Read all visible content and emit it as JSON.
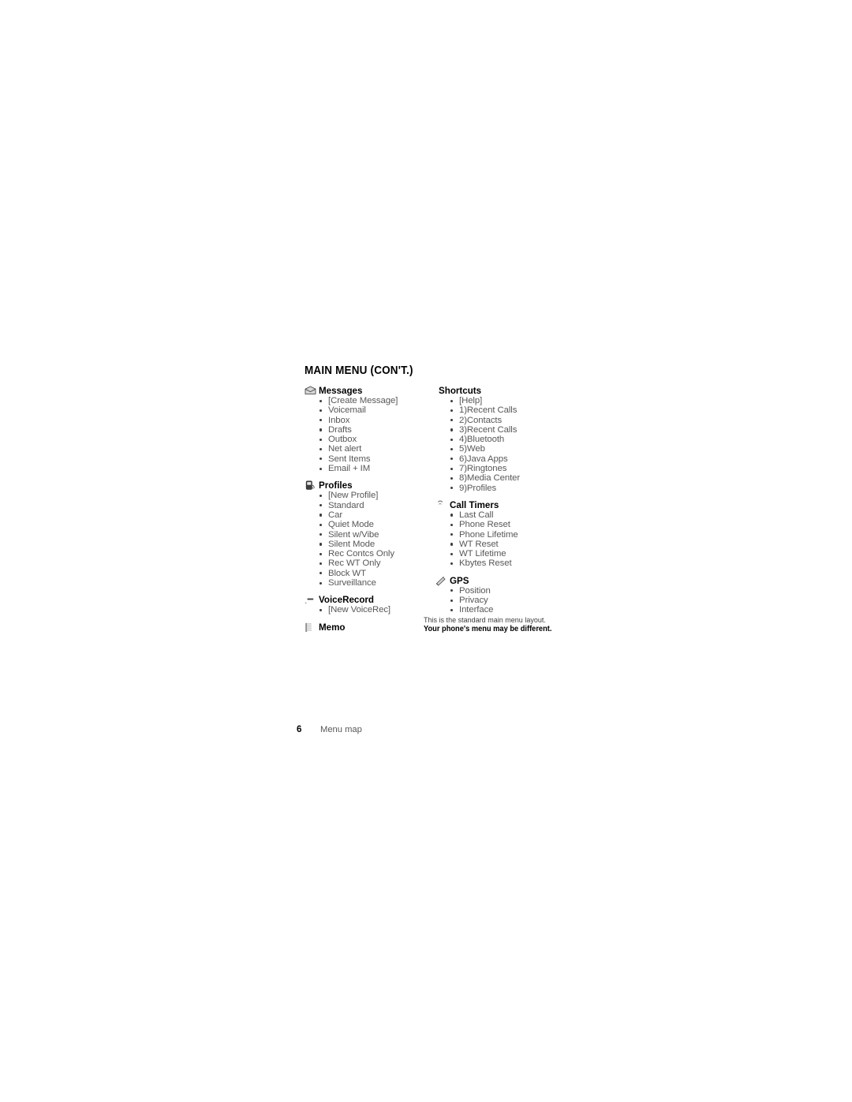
{
  "document": {
    "title": "MAIN MENU (CON'T.)"
  },
  "columns": {
    "left": [
      {
        "id": "messages",
        "heading": "Messages",
        "icon": "envelope-icon",
        "items": [
          "[Create Message]",
          "Voicemail",
          "Inbox",
          "Drafts",
          "Outbox",
          "Net alert",
          "Sent Items",
          "Email + IM"
        ]
      },
      {
        "id": "profiles",
        "heading": "Profiles",
        "icon": "phone-profile-icon",
        "items": [
          "[New Profile]",
          "Standard",
          "Car",
          "Quiet Mode",
          "Silent w/Vibe",
          "Silent Mode",
          "Rec Contcs Only",
          "Rec WT Only",
          "Block WT",
          "Surveillance"
        ]
      },
      {
        "id": "voicerecord",
        "heading": "VoiceRecord",
        "icon": "voice-record-icon",
        "items": [
          "[New VoiceRec]"
        ]
      },
      {
        "id": "memo",
        "heading": "Memo",
        "icon": "memo-notepad-icon",
        "items": []
      }
    ],
    "right": [
      {
        "id": "shortcuts",
        "heading": "Shortcuts",
        "icon": null,
        "items": [
          "[Help]",
          "1)Recent Calls",
          "2)Contacts",
          "3)Recent Calls",
          "4)Bluetooth",
          "5)Web",
          "6)Java Apps",
          "7)Ringtones",
          "8)Media Center",
          "9)Profiles"
        ]
      },
      {
        "id": "call-timers",
        "heading": "Call Timers",
        "icon": "call-timer-icon",
        "items": [
          "Last Call",
          "Phone Reset",
          "Phone Lifetime",
          "WT Reset",
          "WT Lifetime",
          "Kbytes Reset"
        ]
      },
      {
        "id": "gps",
        "heading": "GPS",
        "icon": "gps-satellite-icon",
        "items": [
          "Position",
          "Privacy",
          "Interface"
        ]
      }
    ]
  },
  "note": {
    "line1": "This is the standard main menu layout.",
    "line2": "Your phone's menu may be different."
  },
  "footer": {
    "page_number": "6",
    "label": "Menu map"
  },
  "colors": {
    "heading": "#000000",
    "body": "#58585a",
    "bullet": "#3c3c3e",
    "background": "#ffffff"
  }
}
